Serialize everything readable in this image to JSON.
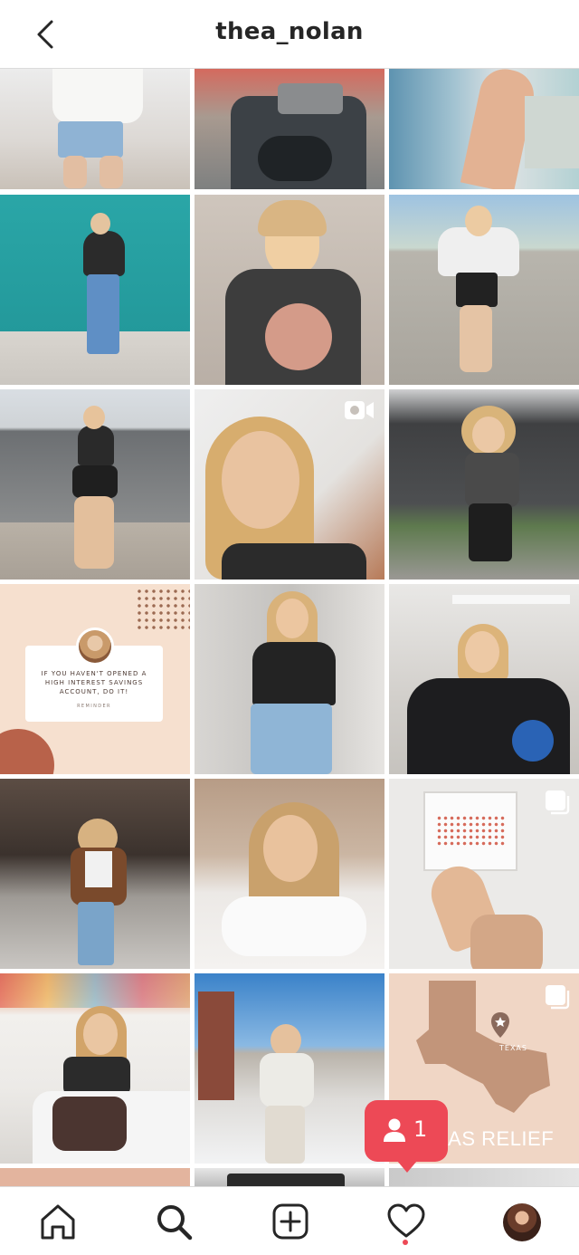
{
  "header": {
    "title": "thea_nolan",
    "back_icon": "chevron-left-icon"
  },
  "quote_post": {
    "text": "IF YOU HAVEN'T OPENED A HIGH INTEREST SAVINGS ACCOUNT, DO IT!",
    "subtext": "REMINDER"
  },
  "texas_post": {
    "map_label": "TEXAS",
    "caption": "XAS RELIEF"
  },
  "notification": {
    "count": "1",
    "icon": "person-icon",
    "color": "#ed4956"
  },
  "bottom_nav": {
    "items": [
      "home-icon",
      "search-icon",
      "new-post-icon",
      "activity-heart-icon",
      "profile-avatar"
    ],
    "activity_dot_color": "#ed4956"
  },
  "colors": {
    "border": "#dbdbdb",
    "text": "#262626"
  }
}
